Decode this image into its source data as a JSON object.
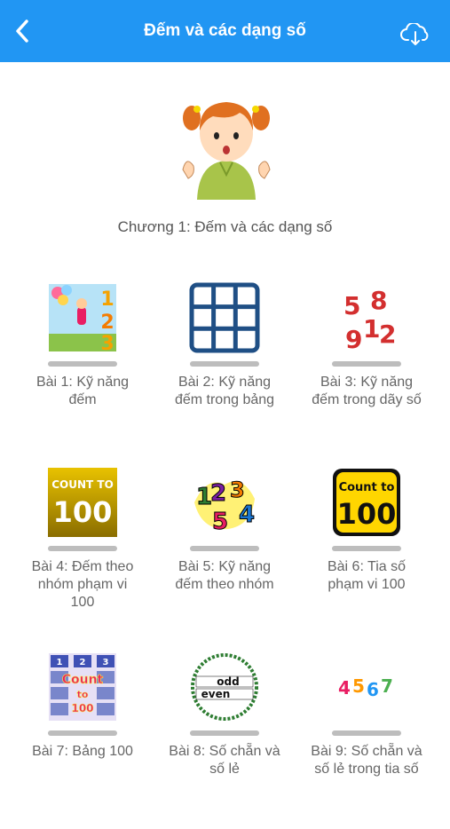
{
  "header": {
    "title": "Đếm và các dạng số",
    "back_icon": "chevron-left-icon",
    "download_icon": "cloud-download-icon",
    "color": "#2196f3"
  },
  "hero": {
    "icon": "girl-counting-fingers-illustration"
  },
  "chapter_title": "Chương 1: Đếm và các dạng số",
  "lessons": [
    {
      "label": "Bài 1: Kỹ năng đếm",
      "icon": "balloon-girl-123-icon",
      "progress": 0
    },
    {
      "label": "Bài 2: Kỹ năng đếm trong bảng",
      "icon": "grid-table-icon",
      "progress": 0
    },
    {
      "label": "Bài 3: Kỹ năng đếm trong dãy số",
      "icon": "scattered-numbers-icon",
      "progress": 0
    },
    {
      "label": "Bài 4: Đếm theo nhóm phạm vi 100",
      "icon": "count-to-100-gold-icon",
      "progress": 0
    },
    {
      "label": "Bài 5: Kỹ năng đếm theo nhóm",
      "icon": "colorful-numbers-icon",
      "progress": 0
    },
    {
      "label": "Bài 6: Tia số phạm vi 100",
      "icon": "count-to-100-yellow-icon",
      "progress": 0
    },
    {
      "label": "Bài 7: Bảng 100",
      "icon": "count-to-100-board-icon",
      "progress": 0
    },
    {
      "label": "Bài 8: Số chẵn và số lẻ",
      "icon": "odd-even-circle-icon",
      "progress": 0
    },
    {
      "label": "Bài 9: Số chẵn và số lẻ trong tia số",
      "icon": "colorful-4567-icon",
      "progress": 0
    }
  ],
  "thumb_text": {
    "l1_nums": "123",
    "l3_nums": [
      "5",
      "8",
      "9",
      "1",
      "2"
    ],
    "l4_top": "COUNT TO",
    "l4_big": "100",
    "l5_nums": "1234",
    "l6_top": "Count to",
    "l6_big": "100",
    "l7_nums": [
      "1",
      "2",
      "3"
    ],
    "l7_title": "Count",
    "l7_to": "to",
    "l7_100": "100",
    "l8_odd": "odd",
    "l8_even": "even",
    "l9_nums": [
      "4",
      "5",
      "6",
      "7"
    ]
  }
}
